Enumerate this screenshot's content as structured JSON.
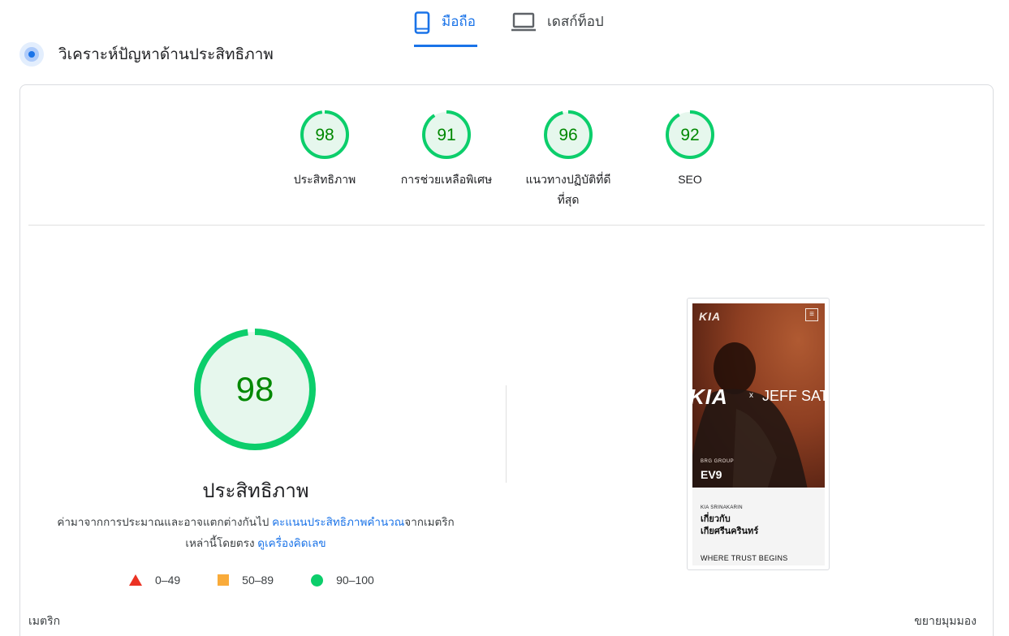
{
  "tabs": {
    "mobile": {
      "label": "มือถือ",
      "icon": "smartphone-icon",
      "active": true
    },
    "desktop": {
      "label": "เดสก์ท็อป",
      "icon": "laptop-icon",
      "active": false
    }
  },
  "section": {
    "title": "วิเคราะห์ปัญหาด้านประสิทธิภาพ",
    "icon": "diagnose-icon"
  },
  "scores": {
    "performance": {
      "value": "98",
      "label": "ประสิทธิภาพ",
      "fraction": 0.98
    },
    "accessibility": {
      "value": "91",
      "label": "การช่วยเหลือพิเศษ",
      "fraction": 0.91
    },
    "best_practices": {
      "value": "96",
      "label": "แนวทางปฏิบัติที่ดีที่สุด",
      "fraction": 0.96
    },
    "seo": {
      "value": "92",
      "label": "SEO",
      "fraction": 0.92
    }
  },
  "main_gauge": {
    "value": "98",
    "fraction": 0.98,
    "label": "ประสิทธิภาพ",
    "desc_part1": "ค่ามาจากการประมาณและอาจแตกต่างกันไป ",
    "desc_link1": "คะแนนประสิทธิภาพคำนวณ",
    "desc_part2": "จากเมตริกเหล่านี้โดยตรง ",
    "desc_link2": "ดูเครื่องคิดเลข"
  },
  "legend": {
    "fail": "0–49",
    "average": "50–89",
    "pass": "90–100"
  },
  "screenshot": {
    "logo": "KIA",
    "menu_icon": "≡",
    "big_logo": "KIA",
    "cross": "x",
    "collab": "JEFF SATU",
    "group": "BRG GROUP",
    "model": "EV9",
    "info_small": "KIA SRINAKARIN",
    "info_title_line1": "เกี่ยวกับ",
    "info_title_line2": "เกียศรีนครินทร์",
    "info_tag": "WHERE TRUST BEGINS"
  },
  "bottom": {
    "metrics_label": "เมตริก",
    "expand_label": "ขยายมุมมอง"
  },
  "colors": {
    "pass": "#0cce6b",
    "pass_bg": "#e6f7ed",
    "pass_text": "#008800",
    "average": "#f9ab3a",
    "fail": "#eb3223",
    "accent": "#1a73e8"
  }
}
